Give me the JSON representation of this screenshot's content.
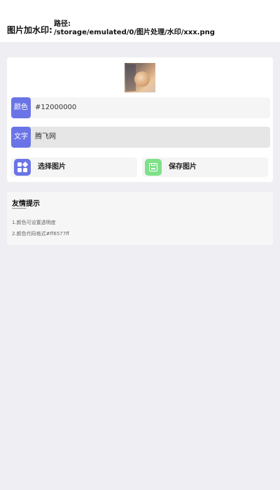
{
  "header": {
    "title": "图片加水印:",
    "path_label": "路径:",
    "path_value": "/storage/emulated/0/图片处理/水印/xxx.png"
  },
  "form": {
    "color_tag": "颜色",
    "color_value": "#12000000",
    "text_tag": "文字",
    "text_value": "腾飞网"
  },
  "buttons": {
    "select_label": "选择图片",
    "save_label": "保存图片"
  },
  "tips": {
    "title": "友情提示",
    "divider": "----------",
    "lines": [
      "1.颜色可设置透明度",
      "2.颜色代码格式#ff6577ff"
    ]
  },
  "colors": {
    "accent": "#6b74e6",
    "save_icon": "#7fe08a",
    "background": "#efeff3"
  }
}
